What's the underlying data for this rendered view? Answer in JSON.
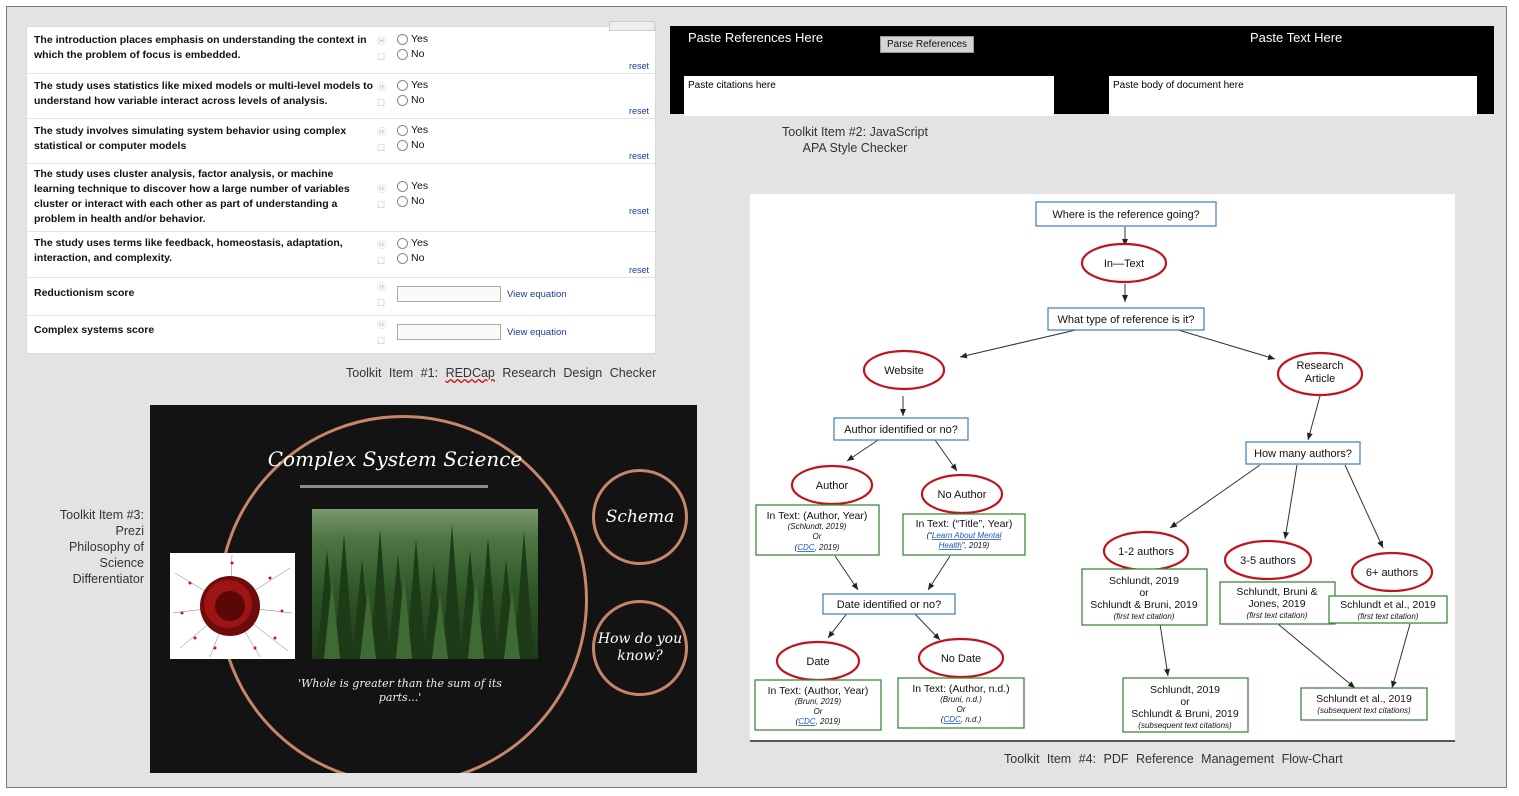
{
  "redcap": {
    "questions": [
      {
        "text": "The introduction places emphasis on understanding the context in which the problem of focus is embedded.",
        "opt1": "Yes",
        "opt2": "No",
        "reset": "reset"
      },
      {
        "text": "The study uses statistics like mixed models or multi-level models to understand how variable interact across levels of analysis.",
        "opt1": "Yes",
        "opt2": "No",
        "reset": "reset"
      },
      {
        "text": "The study involves simulating system behavior using complex statistical or computer models",
        "opt1": "Yes",
        "opt2": "No",
        "reset": "reset"
      },
      {
        "text": "The study uses cluster analysis, factor analysis, or machine learning technique to discover how a large number of variables cluster or interact with each other as part of understanding a problem in health and/or behavior.",
        "opt1": "Yes",
        "opt2": "No",
        "reset": "reset"
      },
      {
        "text": "The study uses terms like feedback, homeostasis, adaptation, interaction, and complexity.",
        "opt1": "Yes",
        "opt2": "No",
        "reset": "reset"
      }
    ],
    "scores": [
      {
        "label": "Reductionism score",
        "link": "View equation"
      },
      {
        "label": "Complex systems score",
        "link": "View equation"
      }
    ],
    "caption_prefix": "Toolkit Item #1:",
    "caption_squiggle": "REDCap",
    "caption_suffix": "Research Design Checker"
  },
  "js_checker": {
    "left_title": "Paste References Here",
    "parse_button": "Parse References",
    "right_title": "Paste Text Here",
    "citations_placeholder": "Paste citations here",
    "body_placeholder": "Paste body of document here",
    "caption_line1": "Toolkit Item #2: JavaScript",
    "caption_line2": "APA Style Checker"
  },
  "prezi": {
    "caption_lines": [
      "Toolkit Item #3:",
      "Prezi",
      "Philosophy of",
      "Science",
      "Differentiator"
    ],
    "title": "Complex System Science",
    "quote": "'Whole is greater than the sum of its parts...'",
    "schema": "Schema",
    "how_line1": "How do you",
    "how_line2": "know?"
  },
  "flowchart": {
    "caption": "Toolkit Item #4: PDF Reference Management Flow-Chart",
    "q_where": "Where is the reference going?",
    "in_text": "In—Text",
    "q_type": "What type of reference is it?",
    "website": "Website",
    "research_1": "Research",
    "research_2": "Article",
    "q_author": "Author identified or no?",
    "q_how_many": "How many authors?",
    "author": "Author",
    "no_author": "No Author",
    "author_box": [
      "In Text: (Author, Year)",
      "(Schlundt, 2019)",
      "Or",
      "(",
      "CDC",
      ", 2019)"
    ],
    "noauthor_box": [
      "In Text: (“Title”, Year)",
      "(“",
      "Learn About Mental",
      "Health",
      "”, 2019)"
    ],
    "q_date": "Date identified or no?",
    "date": "Date",
    "no_date": "No Date",
    "date_box": [
      "In Text: (Author, Year)",
      "(Bruni, 2019)",
      "Or",
      "(",
      "CDC",
      ", 2019)"
    ],
    "nodate_box": [
      "In Text: (Author, n.d.)",
      "(Bruni, n.d.)",
      "Or",
      "(",
      "CDC",
      ", n.d.)"
    ],
    "a12": "1-2 authors",
    "a35": "3-5 authors",
    "a6": "6+ authors",
    "a12_box": [
      "Schlundt, 2019",
      "or",
      "Schlundt & Bruni, 2019",
      "(first text citation)"
    ],
    "a35_box": [
      "Schlundt, Bruni &",
      "Jones, 2019",
      "(first text citation)"
    ],
    "a6_box": [
      "Schlundt et al., 2019",
      "(first text citation)"
    ],
    "a12_sub_box": [
      "Schlundt, 2019",
      "or",
      "Schlundt & Bruni, 2019",
      "(subsequent text citations)"
    ],
    "a6_sub_box": [
      "Schlundt et al., 2019",
      "(subsequent text citations)"
    ],
    "colors": {
      "rect_blue": "#4a86c5",
      "rect_green": "#3c8a3c",
      "ellipse_red": "#c0141c",
      "link_blue": "#1a56c8"
    }
  }
}
